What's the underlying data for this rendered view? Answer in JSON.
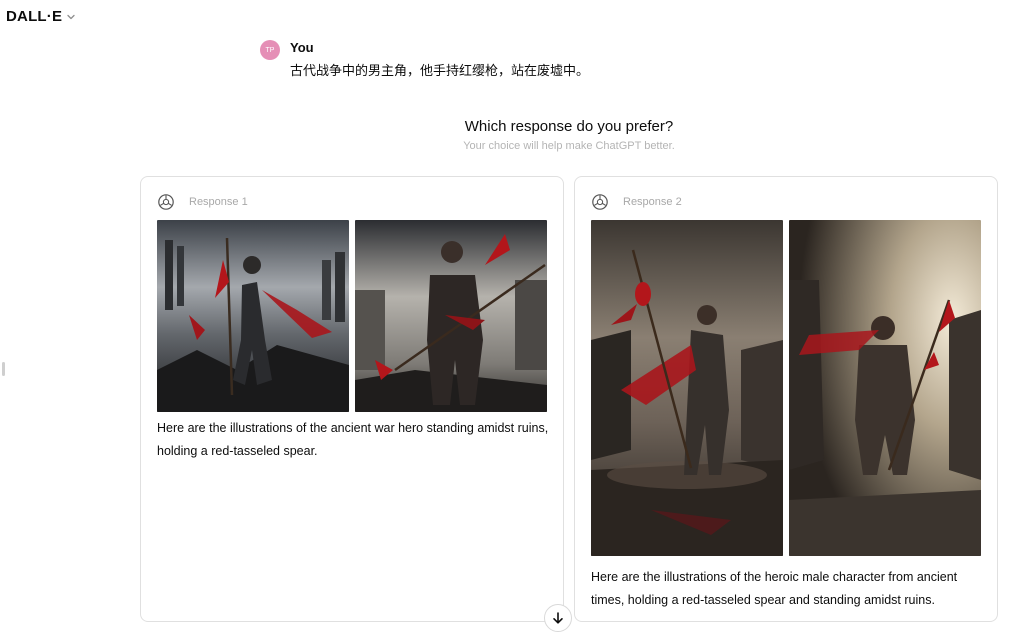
{
  "header": {
    "title": "DALL·E",
    "chevron_icon": "chevron-down-icon"
  },
  "message": {
    "avatar_initials": "TP",
    "author": "You",
    "text": "古代战争中的男主角，他手持红缨枪，站在废墟中。"
  },
  "comparison": {
    "question": "Which response do you prefer?",
    "subtitle": "Your choice will help make ChatGPT better."
  },
  "responses": [
    {
      "label": "Response 1",
      "logo_icon": "openai-logo-icon",
      "caption": "Here are the illustrations of the ancient war hero standing amidst ruins, holding a red-tasseled spear."
    },
    {
      "label": "Response 2",
      "logo_icon": "openai-logo-icon",
      "caption": "Here are the illustrations of the heroic male character from ancient times, holding a red-tasseled spear and standing amidst ruins."
    }
  ],
  "scroll_button_icon": "arrow-down-icon",
  "colors": {
    "avatar_bg": "#e58fb6",
    "border": "#e0e0e0",
    "muted_text": "#b4b4b4"
  }
}
